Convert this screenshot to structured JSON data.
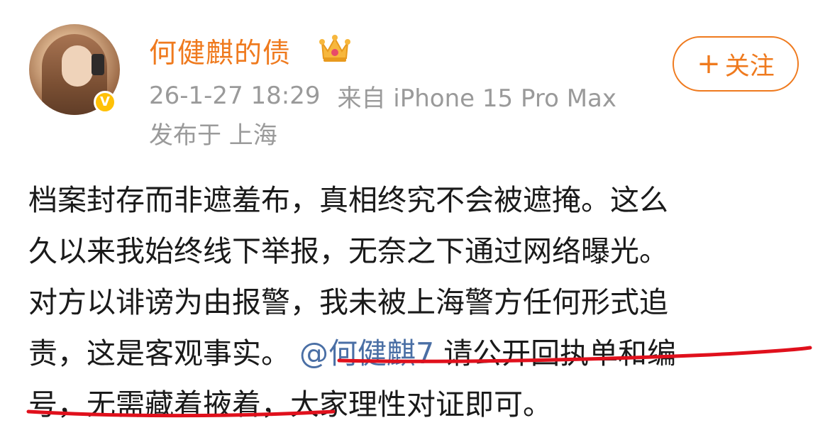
{
  "post": {
    "username": "何健麒的债",
    "timestamp": "26-1-27 18:29",
    "source": "来自 iPhone 15 Pro Max",
    "location": "发布于 上海",
    "follow_label": "关注",
    "follow_plus": "+",
    "verified_mark": "V",
    "text_lines": [
      "档案封存而非遮羞布，真相终究不会被遮掩。这么",
      "久以来我始终线下举报，无奈之下通过网络曝光。",
      "对方以诽谤为由报警，我未被上海警方任何形式追"
    ],
    "line4_before": "责，这是客观事实。",
    "mention": "@何健麒7",
    "line4_after": " 请公开回执单和编",
    "line5": "号，无需藏着掖着，大家理性对证即可。"
  },
  "colors": {
    "username": "#ef7a1e",
    "meta": "#9a9a9a",
    "mention": "#4a6fa5",
    "annotation": "#e0101c",
    "badge": "#ffc107"
  },
  "icons": [
    "avatar",
    "verified-badge-icon",
    "crown-icon",
    "plus-icon"
  ]
}
